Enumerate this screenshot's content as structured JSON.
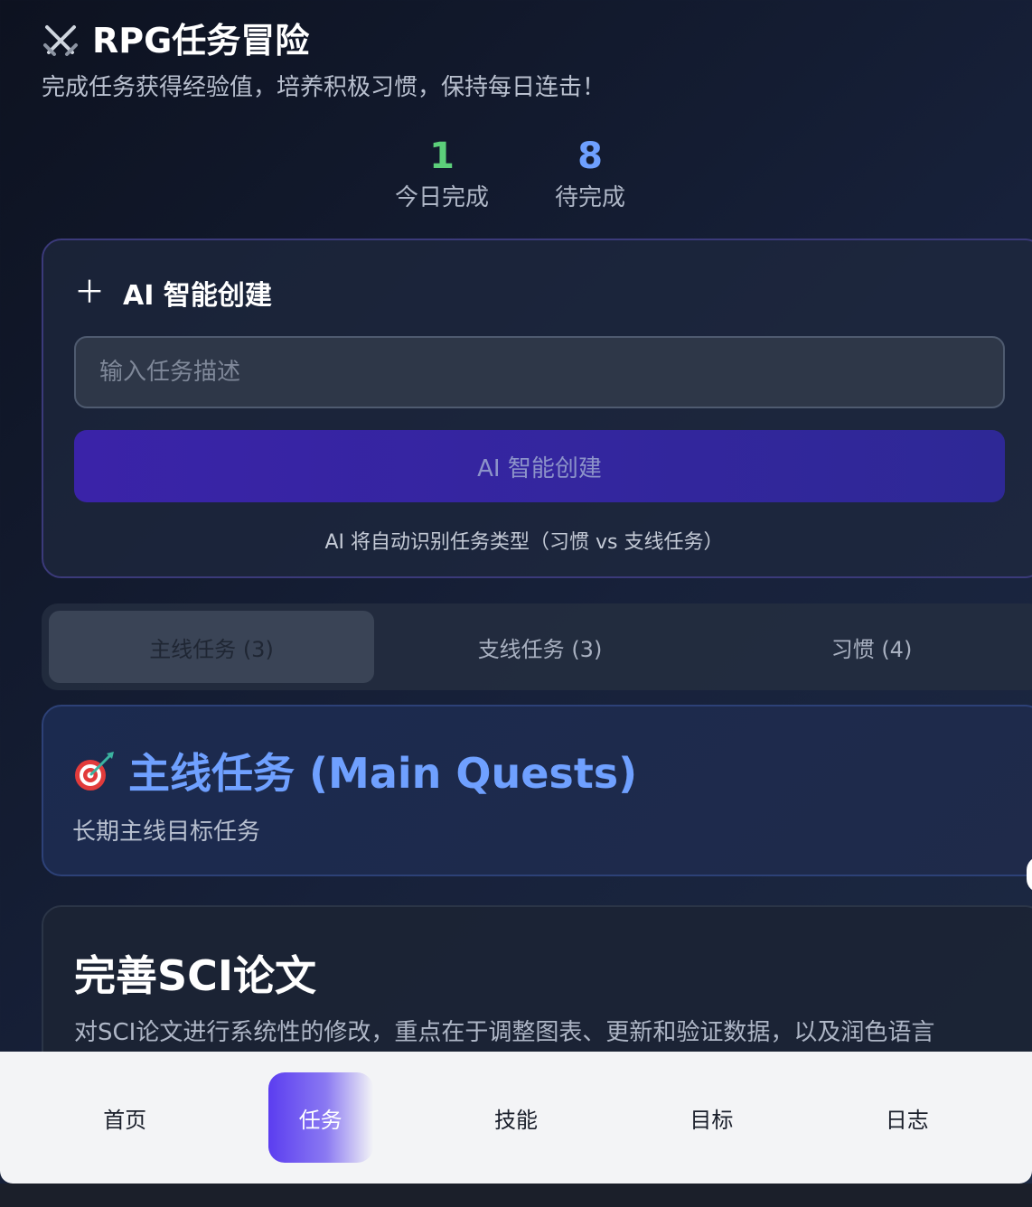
{
  "header": {
    "title": "RPG任务冒险",
    "subtitle": "完成任务获得经验值，培养积极习惯，保持每日连击！",
    "icon": "crossed-swords-icon"
  },
  "stats": [
    {
      "value": "1",
      "label": "今日完成",
      "color": "#5ccf7a"
    },
    {
      "value": "8",
      "label": "待完成",
      "color": "#6ea0ff"
    }
  ],
  "create": {
    "heading": "AI 智能创建",
    "input_placeholder": "输入任务描述",
    "button_label": "AI 智能创建",
    "hint": "AI 将自动识别任务类型（习惯 vs 支线任务）"
  },
  "tabs": [
    {
      "label": "主线任务 (3)",
      "active": true
    },
    {
      "label": "支线任务 (3)",
      "active": false
    },
    {
      "label": "习惯 (4)",
      "active": false
    }
  ],
  "section": {
    "title": "主线任务 (Main Quests)",
    "description": "长期主线目标任务",
    "icon": "target-dart-icon",
    "title_color": "#6fa0ff"
  },
  "task": {
    "title": "完善SCI论文",
    "description": "对SCI论文进行系统性的修改，重点在于调整图表、更新和验证数据，以及润色语言"
  },
  "nav": [
    {
      "label": "首页",
      "active": false
    },
    {
      "label": "任务",
      "active": true
    },
    {
      "label": "技能",
      "active": false
    },
    {
      "label": "目标",
      "active": false
    },
    {
      "label": "日志",
      "active": false
    }
  ],
  "colors": {
    "accent": "#5b3df0",
    "primary_button": "#3a23a8"
  }
}
